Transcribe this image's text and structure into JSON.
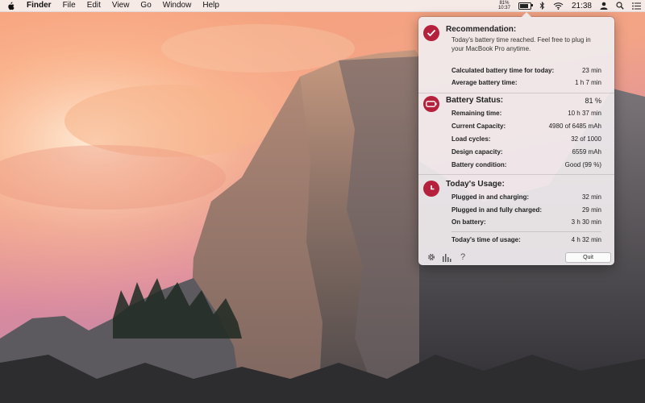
{
  "menubar": {
    "app_name": "Finder",
    "menus": [
      "File",
      "Edit",
      "View",
      "Go",
      "Window",
      "Help"
    ],
    "battery_percent_text": "81%",
    "battery_time_text": "10:37",
    "battery_level": 0.81,
    "clock": "21:38"
  },
  "popover": {
    "recommendation": {
      "title": "Recommendation:",
      "description": "Today's battery time reached. Feel free to plug in your MacBook Pro anytime.",
      "rows": [
        {
          "label": "Calculated battery time for today:",
          "value": "23 min"
        },
        {
          "label": "Average battery time:",
          "value": "1 h 7 min"
        }
      ]
    },
    "battery_status": {
      "title": "Battery Status:",
      "value": "81 %",
      "rows": [
        {
          "label": "Remaining time:",
          "value": "10 h 37 min"
        },
        {
          "label": "Current Capacity:",
          "value": "4980 of 6485 mAh"
        },
        {
          "label": "Load cycles:",
          "value": "32 of 1000"
        },
        {
          "label": "Design capacity:",
          "value": "6559 mAh"
        },
        {
          "label": "Battery condition:",
          "value": "Good (99 %)"
        }
      ]
    },
    "todays_usage": {
      "title": "Today's Usage:",
      "rows": [
        {
          "label": "Plugged in and charging:",
          "value": "32 min"
        },
        {
          "label": "Plugged in and fully charged:",
          "value": "29 min"
        },
        {
          "label": "On battery:",
          "value": "3 h 30 min"
        }
      ],
      "total": {
        "label": "Today's time of usage:",
        "value": "4 h 32 min"
      }
    },
    "footer": {
      "quit_label": "Quit",
      "help_glyph": "?"
    }
  },
  "colors": {
    "accent": "#b5213c"
  }
}
